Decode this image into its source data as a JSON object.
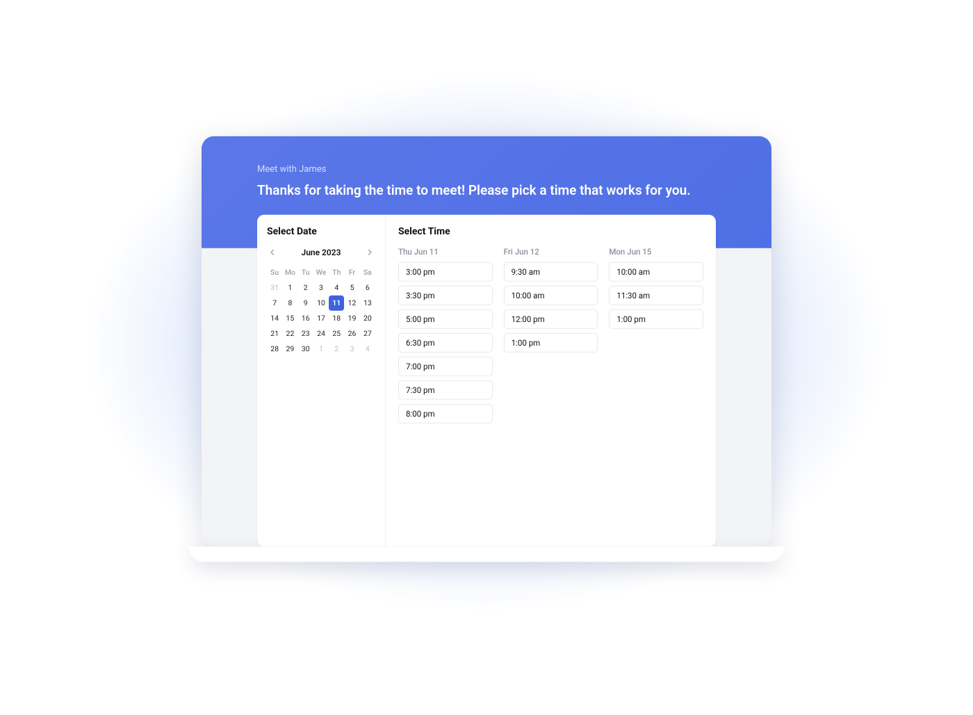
{
  "hero": {
    "eyebrow": "Meet with James",
    "headline": "Thanks for taking the time to meet! Please pick a time that works for you."
  },
  "date_panel": {
    "title": "Select Date",
    "month_label": "June 2023",
    "weekdays": [
      "Su",
      "Mo",
      "Tu",
      "We",
      "Th",
      "Fr",
      "Sa"
    ],
    "weeks": [
      [
        {
          "n": "31",
          "out": true
        },
        {
          "n": "1"
        },
        {
          "n": "2"
        },
        {
          "n": "3"
        },
        {
          "n": "4"
        },
        {
          "n": "5"
        },
        {
          "n": "6"
        }
      ],
      [
        {
          "n": "7"
        },
        {
          "n": "8"
        },
        {
          "n": "9"
        },
        {
          "n": "10"
        },
        {
          "n": "11",
          "sel": true
        },
        {
          "n": "12"
        },
        {
          "n": "13"
        }
      ],
      [
        {
          "n": "14"
        },
        {
          "n": "15"
        },
        {
          "n": "16"
        },
        {
          "n": "17"
        },
        {
          "n": "18"
        },
        {
          "n": "19"
        },
        {
          "n": "20"
        }
      ],
      [
        {
          "n": "21"
        },
        {
          "n": "22"
        },
        {
          "n": "23"
        },
        {
          "n": "24"
        },
        {
          "n": "25"
        },
        {
          "n": "26"
        },
        {
          "n": "27"
        }
      ],
      [
        {
          "n": "28"
        },
        {
          "n": "29"
        },
        {
          "n": "30"
        },
        {
          "n": "1",
          "out": true
        },
        {
          "n": "2",
          "out": true
        },
        {
          "n": "3",
          "out": true
        },
        {
          "n": "4",
          "out": true
        }
      ]
    ]
  },
  "time_panel": {
    "title": "Select Time",
    "columns": [
      {
        "header": "Thu Jun 11",
        "slots": [
          "3:00 pm",
          "3:30 pm",
          "5:00 pm",
          "6:30 pm",
          "7:00 pm",
          "7:30 pm",
          "8:00 pm"
        ]
      },
      {
        "header": "Fri Jun 12",
        "slots": [
          "9:30 am",
          "10:00 am",
          "12:00 pm",
          "1:00 pm"
        ]
      },
      {
        "header": "Mon Jun 15",
        "slots": [
          "10:00 am",
          "11:30 am",
          "1:00 pm"
        ]
      }
    ]
  }
}
